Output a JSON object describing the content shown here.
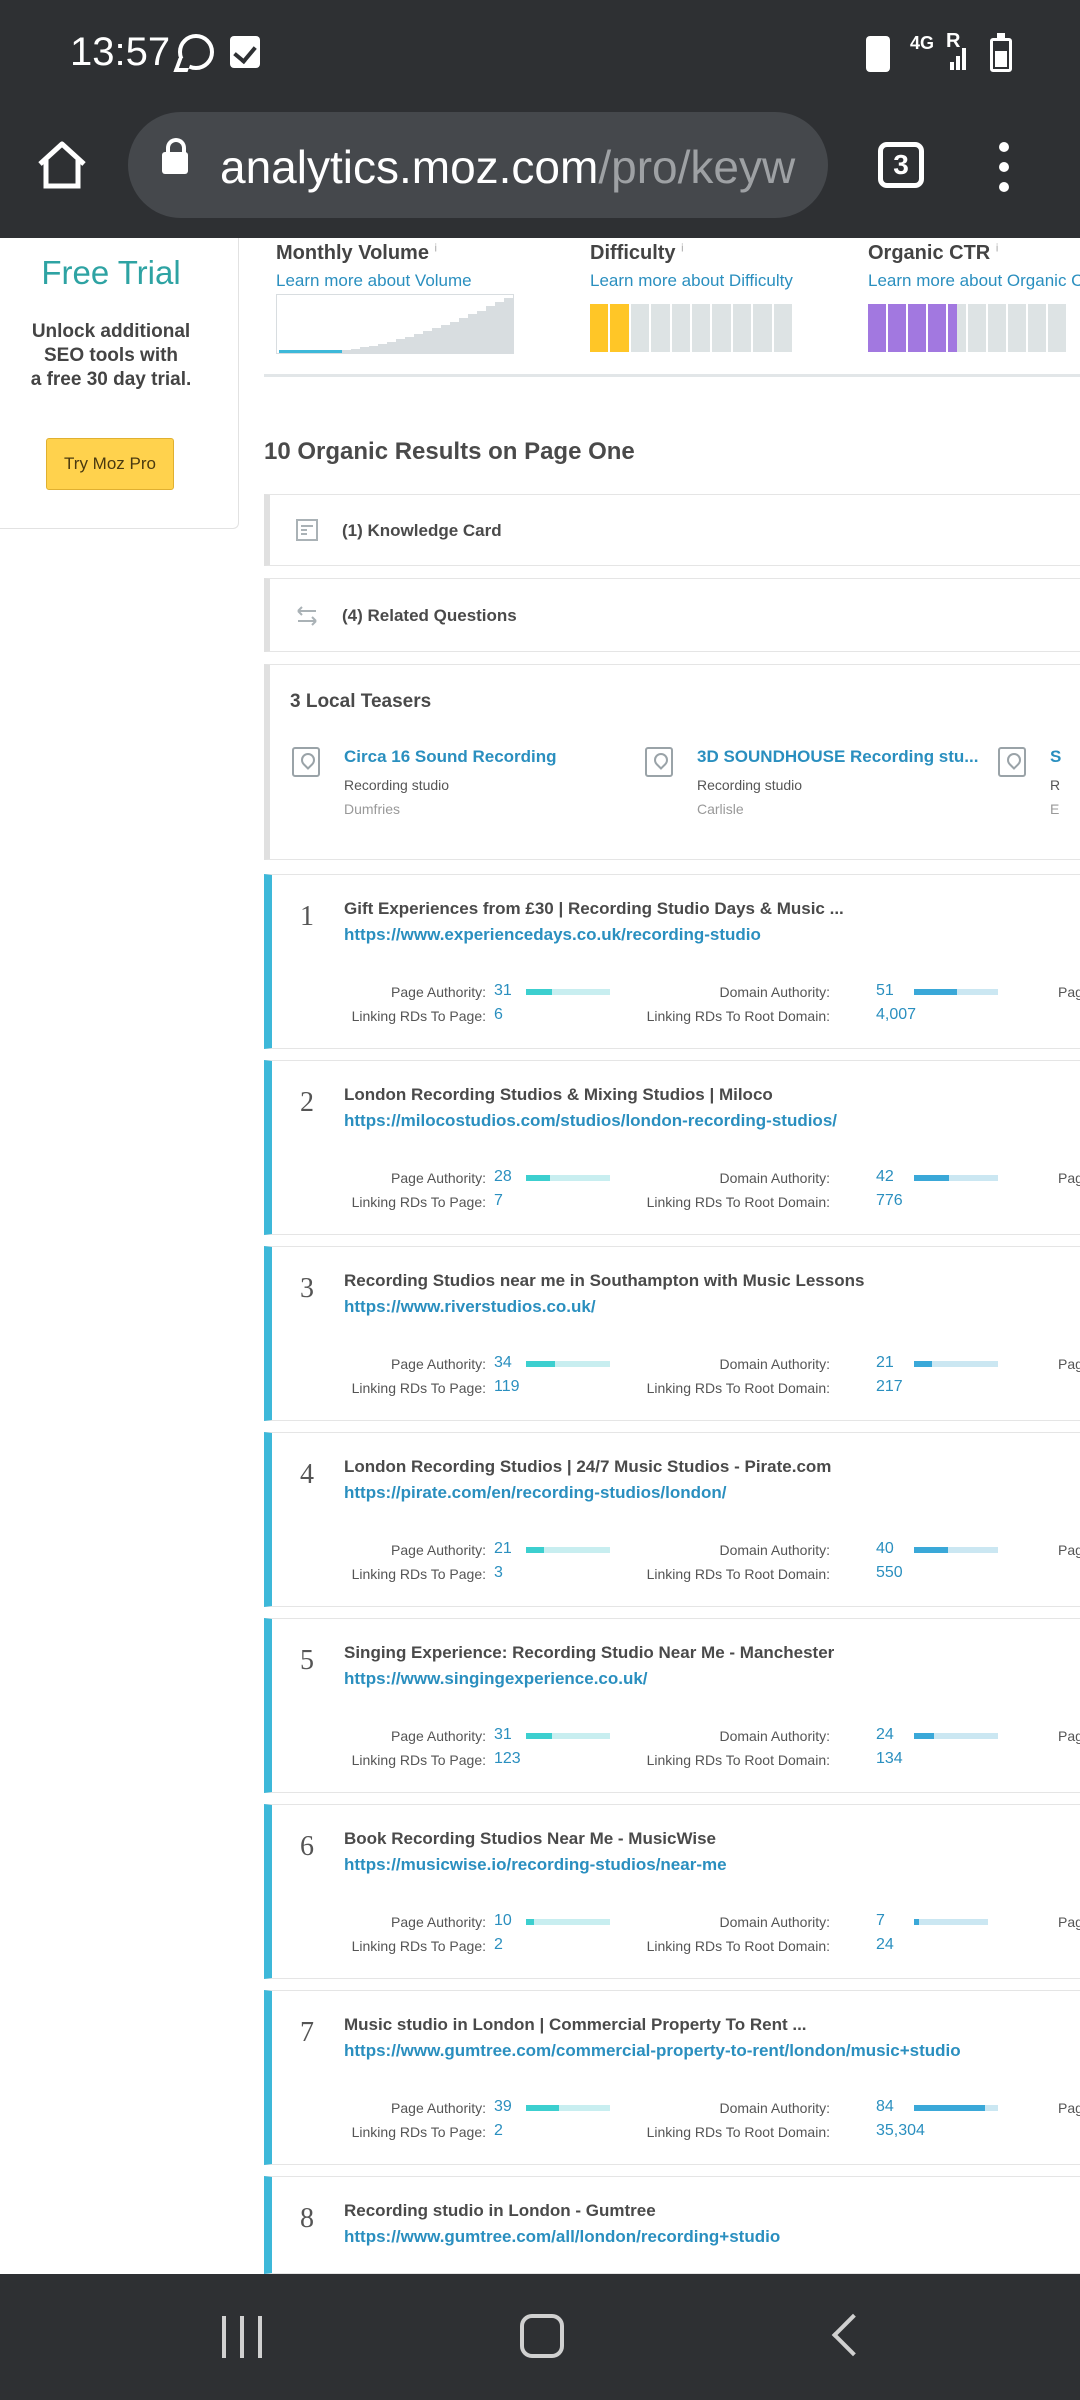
{
  "status": {
    "time": "13:57",
    "network": "4G",
    "roaming": "R"
  },
  "browser": {
    "url_host": "analytics.moz.com",
    "url_path": "/pro/keyw",
    "tab_count": "3"
  },
  "trial": {
    "title": "Free Trial",
    "lines": [
      "Unlock additional",
      "SEO tools with",
      "a free 30 day trial."
    ],
    "button": "Try Moz Pro"
  },
  "metrics": {
    "volume": {
      "label": "Monthly Volume",
      "link": "Learn more about Volume"
    },
    "difficulty": {
      "label": "Difficulty",
      "link": "Learn more about Difficulty",
      "filled_segments": 2,
      "total_segments": 10,
      "color": "#ffc627"
    },
    "ctr": {
      "label": "Organic CTR",
      "link": "Learn more about Organic CTR",
      "filled_segments": 4.5,
      "color": "#a278e0"
    },
    "info_mark": "i"
  },
  "section_title": "10 Organic Results on Page One",
  "features": {
    "knowledge_card": "(1) Knowledge Card",
    "related_questions": "(4) Related Questions"
  },
  "teasers": {
    "title": "3 Local Teasers",
    "items": [
      {
        "name": "Circa 16 Sound Recording",
        "type": "Recording studio",
        "city": "Dumfries"
      },
      {
        "name": "3D SOUNDHOUSE Recording stu...",
        "type": "Recording studio",
        "city": "Carlisle"
      },
      {
        "name": "S",
        "type": "R",
        "city": "E"
      }
    ]
  },
  "stat_labels": {
    "pa": "Page Authority:",
    "lrp": "Linking RDs To Page:",
    "da": "Domain Authority:",
    "lrr": "Linking RDs To Root Domain:",
    "cut": "Pag",
    "cut6": "Page"
  },
  "results": [
    {
      "rank": "1",
      "title": "Gift Experiences from £30 | Recording Studio Days & Music ...",
      "url": "https://www.experiencedays.co.uk/recording-studio",
      "pa": "31",
      "lrp": "6",
      "da": "51",
      "lrr": "4,007"
    },
    {
      "rank": "2",
      "title": "London Recording Studios & Mixing Studios | Miloco",
      "url": "https://milocostudios.com/studios/london-recording-studios/",
      "pa": "28",
      "lrp": "7",
      "da": "42",
      "lrr": "776"
    },
    {
      "rank": "3",
      "title": "Recording Studios near me in Southampton with Music Lessons",
      "url": "https://www.riverstudios.co.uk/",
      "pa": "34",
      "lrp": "119",
      "da": "21",
      "lrr": "217"
    },
    {
      "rank": "4",
      "title": "London Recording Studios | 24/7 Music Studios - Pirate.com",
      "url": "https://pirate.com/en/recording-studios/london/",
      "pa": "21",
      "lrp": "3",
      "da": "40",
      "lrr": "550"
    },
    {
      "rank": "5",
      "title": "Singing Experience: Recording Studio Near Me - Manchester",
      "url": "https://www.singingexperience.co.uk/",
      "pa": "31",
      "lrp": "123",
      "da": "24",
      "lrr": "134"
    },
    {
      "rank": "6",
      "title": "Book Recording Studios Near Me - MusicWise",
      "url": "https://musicwise.io/recording-studios/near-me",
      "pa": "10",
      "lrp": "2",
      "da": "7",
      "lrr": "24"
    },
    {
      "rank": "7",
      "title": "Music studio in London | Commercial Property To Rent ...",
      "url": "https://www.gumtree.com/commercial-property-to-rent/london/music+studio",
      "pa": "39",
      "lrp": "2",
      "da": "84",
      "lrr": "35,304"
    },
    {
      "rank": "8",
      "title": "Recording studio in London - Gumtree",
      "url": "https://www.gumtree.com/all/london/recording+studio"
    }
  ],
  "colors": {
    "accent_teal": "#2ea3a3",
    "link_blue": "#2a8fbf",
    "result_border": "#3db8d9",
    "button_yellow": "#ffd24d"
  }
}
